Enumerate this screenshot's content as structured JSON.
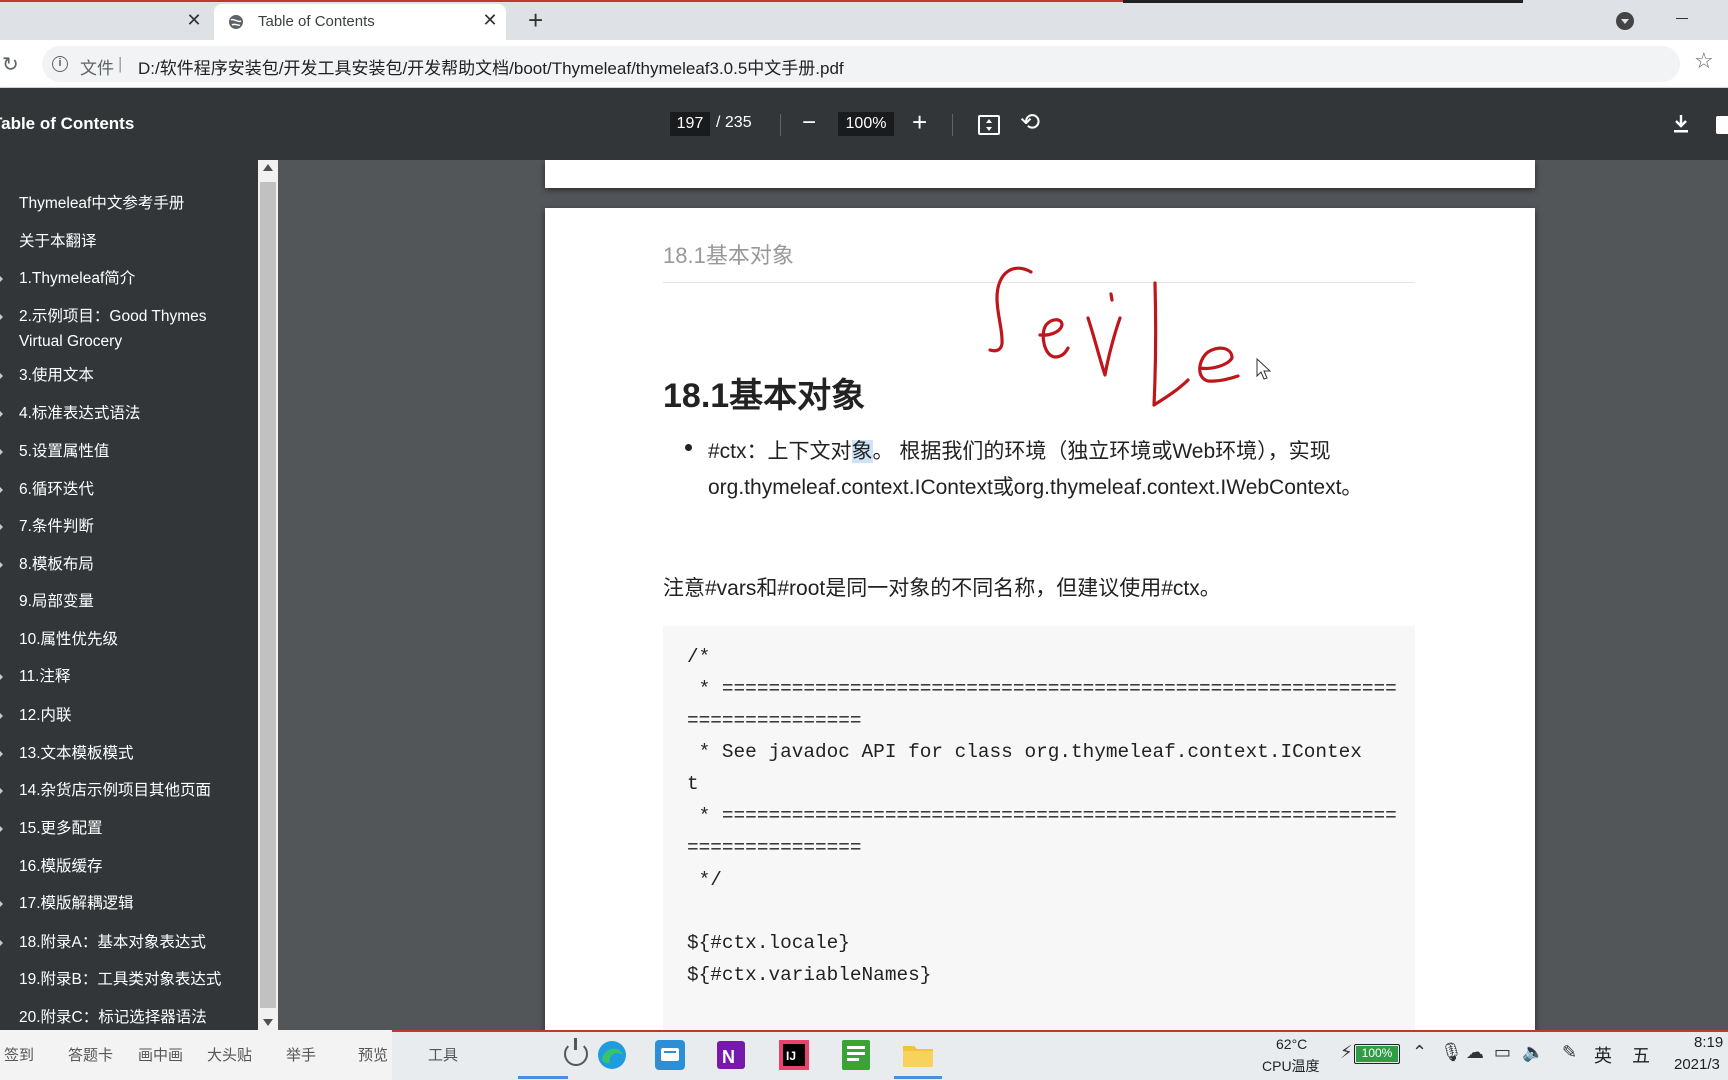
{
  "browser": {
    "active_tab_title": "Table of Contents",
    "prev_tab_close": "✕",
    "active_tab_close": "✕",
    "new_tab": "+",
    "address_label": "文件",
    "address_sep": "|",
    "url": "D:/软件程序安装包/开发工具安装包/开发帮助文档/boot/Thymeleaf/thymeleaf3.0.5中文手册.pdf"
  },
  "pdf_toolbar": {
    "title": "Table of Contents",
    "current_page": "197",
    "total_pages": "/ 235",
    "zoom": "100%",
    "zoom_out": "−",
    "zoom_in": "+"
  },
  "toc": [
    {
      "label": "Thymeleaf中文参考手册",
      "arrow": false
    },
    {
      "label": "关于本翻译",
      "arrow": false
    },
    {
      "label": "1.Thymeleaf简介",
      "arrow": true
    },
    {
      "label": "2.示例项目：Good Thymes Virtual Grocery",
      "arrow": true
    },
    {
      "label": "3.使用文本",
      "arrow": true
    },
    {
      "label": "4.标准表达式语法",
      "arrow": true
    },
    {
      "label": "5.设置属性值",
      "arrow": true
    },
    {
      "label": "6.循环迭代",
      "arrow": true
    },
    {
      "label": "7.条件判断",
      "arrow": true
    },
    {
      "label": "8.模板布局",
      "arrow": true
    },
    {
      "label": "9.局部变量",
      "arrow": false
    },
    {
      "label": "10.属性优先级",
      "arrow": false
    },
    {
      "label": "11.注释",
      "arrow": true
    },
    {
      "label": "12.内联",
      "arrow": true
    },
    {
      "label": "13.文本模板模式",
      "arrow": true
    },
    {
      "label": "14.杂货店示例项目其他页面",
      "arrow": true
    },
    {
      "label": "15.更多配置",
      "arrow": true
    },
    {
      "label": "16.模版缓存",
      "arrow": false
    },
    {
      "label": "17.模版解耦逻辑",
      "arrow": true
    },
    {
      "label": "18.附录A：基本对象表达式",
      "arrow": true
    },
    {
      "label": "19.附录B：工具类对象表达式",
      "arrow": false
    },
    {
      "label": "20.附录C：标记选择器语法",
      "arrow": false
    }
  ],
  "page": {
    "running_head": "18.1基本对象",
    "heading": "18.1基本对象",
    "bullet_pre": "#ctx：上下文对",
    "bullet_hl": "象",
    "bullet_post": "。 根据我们的环境（独立环境或Web环境），实现org.thymeleaf.context.IContext或org.thymeleaf.context.IWebContext。",
    "note": "注意#vars和#root是同一对象的不同名称，但建议使用#ctx。",
    "code": "/*\n * ==========================================================\n===============\n * See javadoc API for class org.thymeleaf.context.IContex\nt\n * ==========================================================\n===============\n */\n\n${#ctx.locale}\n${#ctx.variableNames}"
  },
  "handwriting": "Sevle",
  "taskbar": {
    "tools": [
      "签到",
      "答题卡",
      "画中画",
      "大头贴",
      "举手",
      "预览",
      "工具"
    ],
    "apps": [
      "edge-icon",
      "app-store-icon",
      "onenote-icon",
      "intellij-icon",
      "notepad-icon",
      "file-explorer-icon"
    ],
    "temp": "62°C",
    "temp_label": "CPU温度",
    "battery": "100%",
    "ime": "英",
    "ime2": "五",
    "time": "8:19",
    "date": "2021/3"
  },
  "colors": {
    "toolbar_bg": "#323639",
    "viewer_bg": "#525659",
    "ink": "#c0161b",
    "selection": "#cfe3f6"
  }
}
